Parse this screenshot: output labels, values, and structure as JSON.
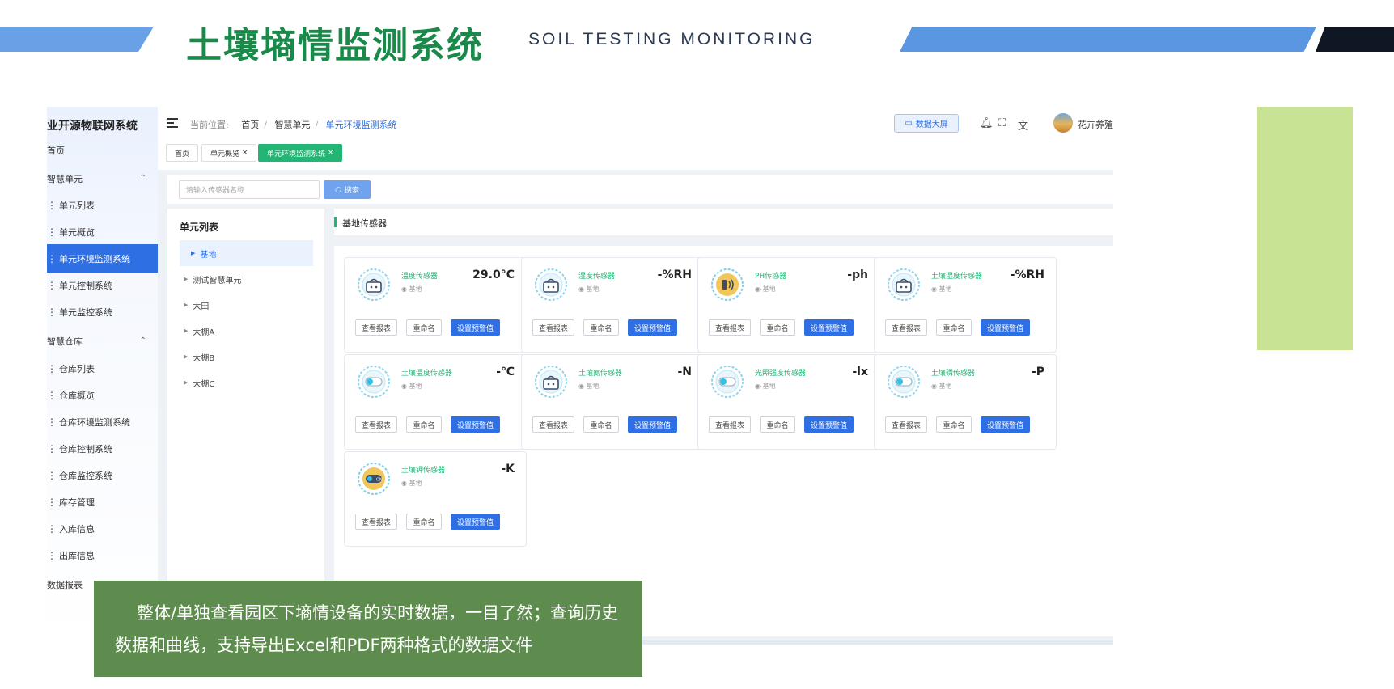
{
  "slide": {
    "title": "土壤墒情监测系统",
    "subtitle": "SOIL TESTING MONITORING",
    "caption": "整体/单独查看园区下墒情设备的实时数据，一目了然；查询历史数据和曲线，支持导出Excel和PDF两种格式的数据文件"
  },
  "app": {
    "logo": "业开源物联网系统",
    "breadcrumb": {
      "prefix": "当前位置:",
      "items": [
        "首页",
        "智慧单元",
        "单元环境监测系统"
      ]
    },
    "bigscreen_label": "数据大屏",
    "username": "花卉养殖"
  },
  "sidebar": {
    "items": [
      {
        "label": "首页",
        "type": "top"
      },
      {
        "label": "智慧单元",
        "type": "group"
      },
      {
        "label": "单元列表",
        "type": "sub"
      },
      {
        "label": "单元概览",
        "type": "sub"
      },
      {
        "label": "单元环境监测系统",
        "type": "sub",
        "active": true
      },
      {
        "label": "单元控制系统",
        "type": "sub"
      },
      {
        "label": "单元监控系统",
        "type": "sub"
      },
      {
        "label": "智慧仓库",
        "type": "group"
      },
      {
        "label": "仓库列表",
        "type": "sub"
      },
      {
        "label": "仓库概览",
        "type": "sub"
      },
      {
        "label": "仓库环境监测系统",
        "type": "sub"
      },
      {
        "label": "仓库控制系统",
        "type": "sub"
      },
      {
        "label": "仓库监控系统",
        "type": "sub"
      },
      {
        "label": "库存管理",
        "type": "sub"
      },
      {
        "label": "入库信息",
        "type": "sub"
      },
      {
        "label": "出库信息",
        "type": "sub"
      },
      {
        "label": "数据报表",
        "type": "top"
      }
    ]
  },
  "tabs": [
    {
      "label": "首页",
      "closable": false,
      "active": false
    },
    {
      "label": "单元概览",
      "closable": true,
      "active": false
    },
    {
      "label": "单元环境监测系统",
      "closable": true,
      "active": true
    }
  ],
  "search": {
    "placeholder": "请输入传感器名称",
    "button": "搜索"
  },
  "unit_list": {
    "title": "单元列表",
    "items": [
      "基地",
      "测试智慧单元",
      "大田",
      "大棚A",
      "大棚B",
      "大棚C"
    ]
  },
  "sensor_section": {
    "title": "基地传感器"
  },
  "card_buttons": {
    "report": "查看报表",
    "rename": "重命名",
    "threshold": "设置预警值"
  },
  "sensors": [
    {
      "name": "温度传感器",
      "location": "基地",
      "value": "29.0°C",
      "icon": "router-icon"
    },
    {
      "name": "湿度传感器",
      "location": "基地",
      "value": "-%RH",
      "icon": "router-icon"
    },
    {
      "name": "PH传感器",
      "location": "基地",
      "value": "-ph",
      "icon": "ph-icon"
    },
    {
      "name": "土壤湿度传感器",
      "location": "基地",
      "value": "-%RH",
      "icon": "router-icon"
    },
    {
      "name": "土壤温度传感器",
      "location": "基地",
      "value": "-℃",
      "icon": "toggle-icon"
    },
    {
      "name": "土壤氮传感器",
      "location": "基地",
      "value": "-N",
      "icon": "router-icon"
    },
    {
      "name": "光照强度传感器",
      "location": "基地",
      "value": "-lx",
      "icon": "toggle-icon"
    },
    {
      "name": "土壤磷传感器",
      "location": "基地",
      "value": "-P",
      "icon": "toggle-icon"
    },
    {
      "name": "土壤钾传感器",
      "location": "基地",
      "value": "-K",
      "icon": "on-toggle-icon"
    }
  ],
  "colors": {
    "accent": "#2f6fe4",
    "green": "#22b573",
    "title_green": "#1a8a4a",
    "caption_bg": "#5e8c4e"
  }
}
